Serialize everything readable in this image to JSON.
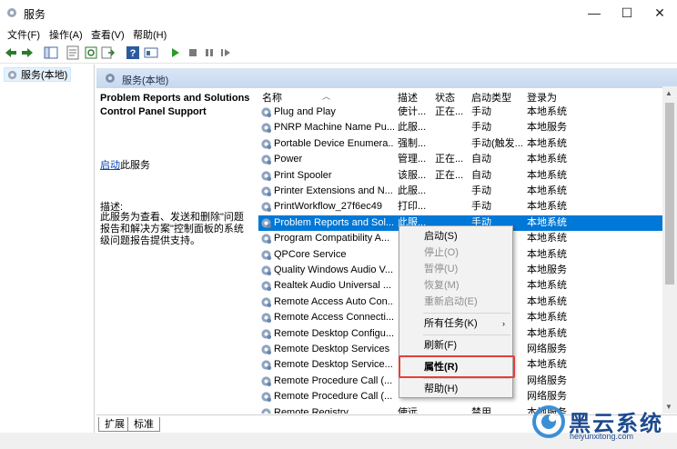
{
  "window": {
    "title": "服务",
    "minimize": "—",
    "maximize": "☐",
    "close": "✕"
  },
  "menu": [
    "文件(F)",
    "操作(A)",
    "查看(V)",
    "帮助(H)"
  ],
  "tree": {
    "root": "服务(本地)"
  },
  "content_header": "服务(本地)",
  "description_panel": {
    "name": "Problem Reports and Solutions Control Panel Support",
    "start_link": "启动",
    "start_suffix": "此服务",
    "desc_label": "描述:",
    "desc_text": "此服务为查看、发送和删除\"问题报告和解决方案\"控制面板的系统级问题报告提供支持。"
  },
  "columns": {
    "name": "名称",
    "desc": "描述",
    "status": "状态",
    "startup": "启动类型",
    "logon": "登录为"
  },
  "rows": [
    {
      "name": "Plug and Play",
      "desc": "使计...",
      "status": "正在...",
      "startup": "手动",
      "logon": "本地系统"
    },
    {
      "name": "PNRP Machine Name Pu...",
      "desc": "此服...",
      "status": "",
      "startup": "手动",
      "logon": "本地服务"
    },
    {
      "name": "Portable Device Enumera...",
      "desc": "强制...",
      "status": "",
      "startup": "手动(触发...",
      "logon": "本地系统"
    },
    {
      "name": "Power",
      "desc": "管理...",
      "status": "正在...",
      "startup": "自动",
      "logon": "本地系统"
    },
    {
      "name": "Print Spooler",
      "desc": "该服...",
      "status": "正在...",
      "startup": "自动",
      "logon": "本地系统"
    },
    {
      "name": "Printer Extensions and N...",
      "desc": "此服...",
      "status": "",
      "startup": "手动",
      "logon": "本地系统"
    },
    {
      "name": "PrintWorkflow_27f6ec49",
      "desc": "打印...",
      "status": "",
      "startup": "手动",
      "logon": "本地系统"
    },
    {
      "name": "Problem Reports and Sol...",
      "desc": "此服...",
      "status": "",
      "startup": "手动",
      "logon": "本地系统"
    },
    {
      "name": "Program Compatibility A...",
      "desc": "",
      "status": "",
      "startup": "",
      "logon": "本地系统"
    },
    {
      "name": "QPCore Service",
      "desc": "",
      "status": "",
      "startup": "",
      "logon": "本地系统"
    },
    {
      "name": "Quality Windows Audio V...",
      "desc": "",
      "status": "",
      "startup": "",
      "logon": "本地服务"
    },
    {
      "name": "Realtek Audio Universal ...",
      "desc": "",
      "status": "",
      "startup": "",
      "logon": "本地系统"
    },
    {
      "name": "Remote Access Auto Con...",
      "desc": "",
      "status": "",
      "startup": "",
      "logon": "本地系统"
    },
    {
      "name": "Remote Access Connecti...",
      "desc": "",
      "status": "",
      "startup": "",
      "logon": "本地系统"
    },
    {
      "name": "Remote Desktop Configu...",
      "desc": "",
      "status": "",
      "startup": "",
      "logon": "本地系统"
    },
    {
      "name": "Remote Desktop Services",
      "desc": "",
      "status": "",
      "startup": "",
      "logon": "网络服务"
    },
    {
      "name": "Remote Desktop Service...",
      "desc": "",
      "status": "",
      "startup": "",
      "logon": "本地系统"
    },
    {
      "name": "Remote Procedure Call (...",
      "desc": "",
      "status": "",
      "startup": "",
      "logon": "网络服务"
    },
    {
      "name": "Remote Procedure Call (...",
      "desc": "",
      "status": "",
      "startup": "",
      "logon": "网络服务"
    },
    {
      "name": "Remote Registry",
      "desc": "使远...",
      "status": "",
      "startup": "禁用",
      "logon": "本地服务"
    }
  ],
  "context_menu": {
    "start": "启动(S)",
    "stop": "停止(O)",
    "pause": "暂停(U)",
    "resume": "恢复(M)",
    "restart": "重新启动(E)",
    "all_tasks": "所有任务(K)",
    "refresh": "刷新(F)",
    "properties": "属性(R)",
    "help": "帮助(H)"
  },
  "tabs": [
    "扩展",
    "标准"
  ],
  "watermark": {
    "brand": "黑云系统",
    "url": "heiyunxitong.com"
  },
  "colors": {
    "selection": "#0078d7",
    "highlight": "#e0413a",
    "brand": "#1d4a8f"
  }
}
